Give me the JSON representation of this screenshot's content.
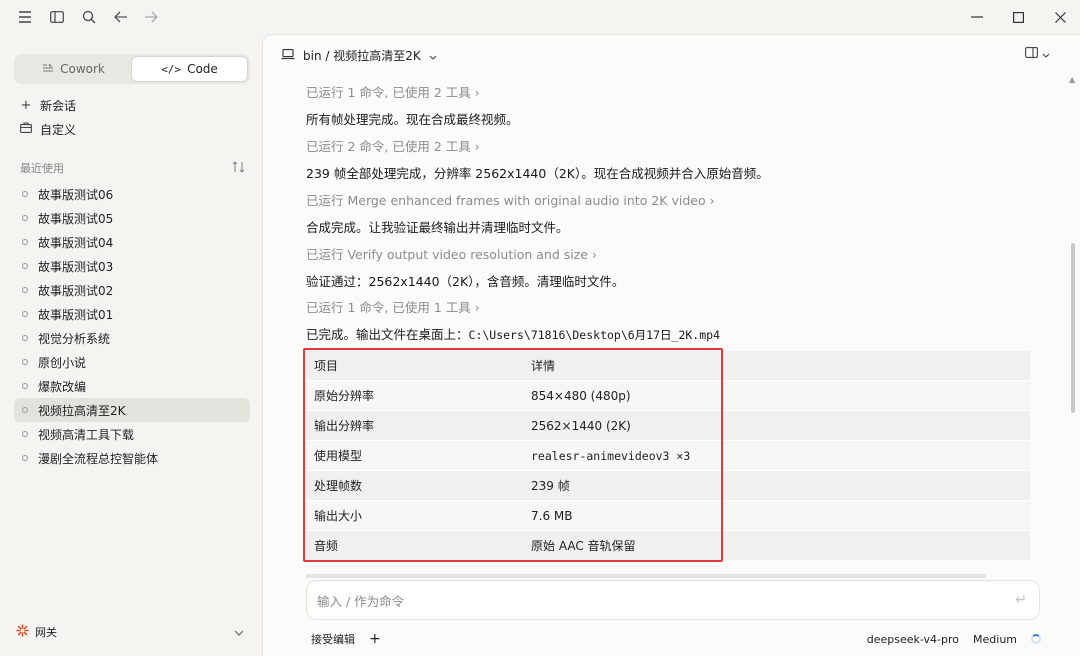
{
  "sidebar": {
    "modes": [
      {
        "label": "Cowork",
        "icon": "cowork-icon",
        "active": false
      },
      {
        "label": "Code",
        "icon": "code-icon",
        "active": true
      }
    ],
    "actions": [
      {
        "label": "新会话",
        "icon": "plus-icon"
      },
      {
        "label": "自定义",
        "icon": "briefcase-icon"
      }
    ],
    "recent_label": "最近使用",
    "recent": [
      "故事版测试06",
      "故事版测试05",
      "故事版测试04",
      "故事版测试03",
      "故事版测试02",
      "故事版测试01",
      "视觉分析系统",
      "原创小说",
      "爆款改编",
      "视频拉高清至2K",
      "视频高清工具下载",
      "漫剧全流程总控智能体"
    ],
    "active_recent": "视频拉高清至2K",
    "gateway_label": "网关"
  },
  "header": {
    "breadcrumb": "bin / 视频拉高清至2K"
  },
  "messages": [
    {
      "kind": "tool",
      "text": "已运行 1 命令, 已使用 2 工具 ›"
    },
    {
      "kind": "text",
      "text": "所有帧处理完成。现在合成最终视频。"
    },
    {
      "kind": "tool",
      "text": "已运行 2 命令, 已使用 2 工具 ›"
    },
    {
      "kind": "text",
      "text": "239 帧全部处理完成，分辨率 2562x1440（2K）。现在合成视频并合入原始音频。"
    },
    {
      "kind": "tool",
      "text": "已运行 Merge enhanced frames with original audio into 2K video ›"
    },
    {
      "kind": "text",
      "text": "合成完成。让我验证最终输出并清理临时文件。"
    },
    {
      "kind": "tool",
      "text": "已运行 Verify output video resolution and size ›"
    },
    {
      "kind": "text",
      "text": "验证通过：2562x1440（2K），含音频。清理临时文件。"
    },
    {
      "kind": "tool",
      "text": "已运行 1 命令, 已使用 1 工具 ›"
    }
  ],
  "final": {
    "prefix": "已完成。输出文件在桌面上：",
    "path": "C:\\Users\\71816\\Desktop\\6月17日_2K.mp4"
  },
  "table": {
    "headers": [
      "项目",
      "详情"
    ],
    "rows": [
      [
        "原始分辨率",
        "854×480 (480p)"
      ],
      [
        "输出分辨率",
        "2562×1440 (2K)"
      ],
      [
        "使用模型",
        "realesr-animevideov3 ×3"
      ],
      [
        "处理帧数",
        "239 帧"
      ],
      [
        "输出大小",
        "7.6 MB"
      ],
      [
        "音频",
        "原始 AAC 音轨保留"
      ]
    ]
  },
  "input": {
    "placeholder": "输入 / 作为命令"
  },
  "footer": {
    "accept_edits": "接受编辑",
    "model": "deepseek-v4-pro",
    "effort": "Medium"
  },
  "colors": {
    "highlight": "#e0383b",
    "accent": "#d9532f"
  }
}
